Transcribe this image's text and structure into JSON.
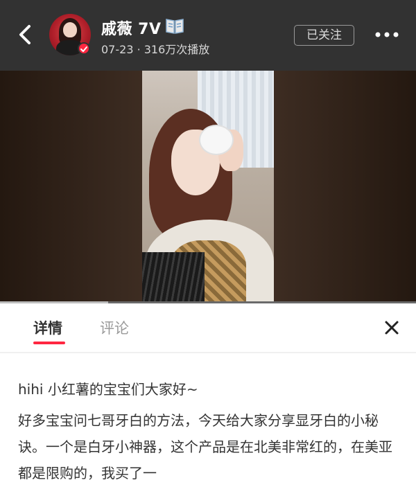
{
  "header": {
    "user_name": "戚薇 7V",
    "meta": "07-23 · 316万次播放",
    "follow_label": "已关注"
  },
  "video": {
    "progress": 0.26
  },
  "panel": {
    "tabs": [
      {
        "label": "详情",
        "active": true
      },
      {
        "label": "评论",
        "active": false
      }
    ],
    "content_title": "hihi 小红薯的宝宝们大家好~",
    "content_body": "好多宝宝问七哥牙白的方法，今天给大家分享显牙白的小秘诀。一个是白牙小神器，这个产品是在北美非常红的，在美亚都是限购的，我买了一"
  },
  "colors": {
    "header_bg": "#323232",
    "accent": "#ff2741",
    "text": "#333333",
    "muted": "#9a9a9a"
  },
  "icons": [
    "back-arrow-icon",
    "book-icon",
    "verified-icon",
    "more-dots-icon",
    "close-icon"
  ]
}
